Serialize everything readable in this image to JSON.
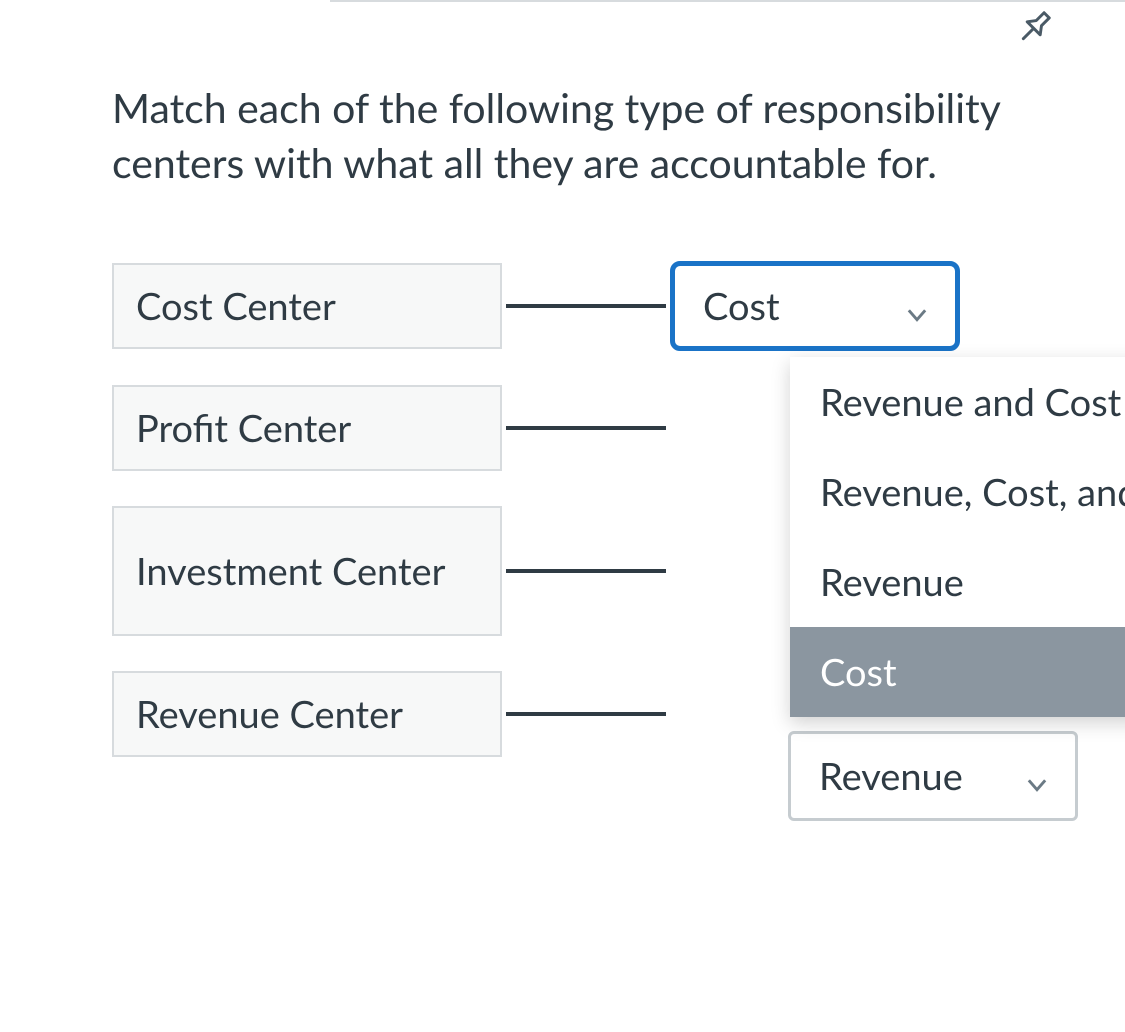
{
  "question": "Match each of the following type of responsibility centers with what all they are accountable for.",
  "rows": [
    {
      "label": "Cost Center",
      "selected": "Cost",
      "focused": true
    },
    {
      "label": "Profit Center",
      "selected": ""
    },
    {
      "label": "Investment Center",
      "selected": ""
    },
    {
      "label": "Revenue Center",
      "selected": "Revenue"
    }
  ],
  "dropdown": {
    "options": [
      "Revenue and Cost",
      "Revenue, Cost, and",
      "Revenue",
      "Cost"
    ],
    "highlighted": "Cost"
  },
  "icons": {
    "pin": "pin-icon",
    "chevron": "chevron-down-icon"
  }
}
